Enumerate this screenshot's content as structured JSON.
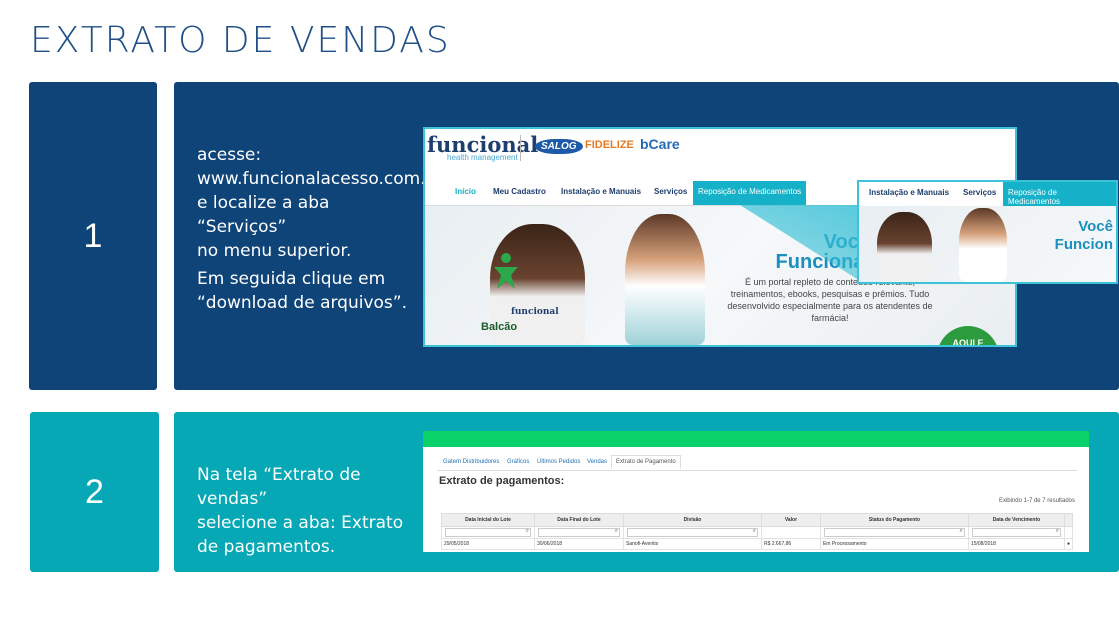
{
  "page": {
    "title": "EXTRATO DE VENDAS"
  },
  "steps": [
    {
      "number": "1",
      "lines": [
        "acesse:",
        "www.funcionalacesso.com.br",
        "e localize a aba “Serviços”",
        "no menu superior.",
        "Em seguida clique em",
        "“download de arquivos”."
      ]
    },
    {
      "number": "2",
      "lines": [
        "Na tela “Extrato de vendas”",
        "selecione a aba: Extrato",
        "de pagamentos."
      ]
    }
  ],
  "shot1": {
    "brand": "funcional",
    "brand_sub": "health management",
    "partners": [
      "SALOG",
      "FIDELIZE",
      "bCare"
    ],
    "menu": [
      "Início",
      "Meu Cadastro",
      "Instalação e Manuais",
      "Serviços",
      "Reposição de Medicamentos"
    ],
    "hero_title": "Você\nFuncional",
    "hero_text": "É um portal repleto de conteúdo relevante, treinamentos, ebooks, pesquisas e prêmios. Tudo desenvolvido especialmente para os atendentes de farmácia!",
    "balcao_top": "funcional",
    "balcao": "Balcão",
    "badge": "AQUI E\nCONFIRA",
    "zoom_menu": [
      "Instalação e Manuais",
      "Serviços",
      "Reposição de Medicamentos"
    ],
    "zoom_title": "Você\nFuncion"
  },
  "shot2": {
    "tabs": [
      "Gatem Distribuidores",
      "Gráficos",
      "Últimos Pedidos",
      "Vendas",
      "Extrato de Pagamento"
    ],
    "heading": "Extrato de pagamentos:",
    "showing": "Exibindo 1-7 de 7 resultados",
    "columns": [
      "Data Inicial do Lote",
      "Data Final do Lote",
      "Divisão",
      "Valor",
      "Status do Pagamento",
      "Data de Vencimento",
      ""
    ],
    "row": [
      "29/05/2018",
      "30/06/2018",
      "Sanofi-Aventis",
      "R$ 2.667,86",
      "Em Processamento",
      "15/08/2018",
      ""
    ]
  },
  "colors": {
    "navy": "#0f4479",
    "teal": "#06a8b5",
    "title": "#1e4f86"
  }
}
